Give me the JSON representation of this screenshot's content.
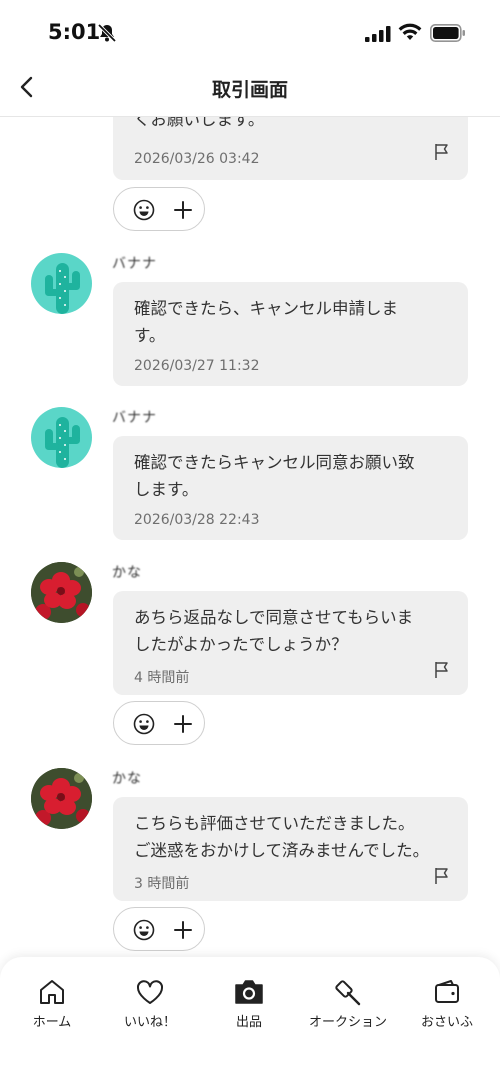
{
  "status_bar": {
    "time": "5:01",
    "icons": [
      "bell-muted-icon",
      "signal-icon",
      "wifi-icon",
      "battery-icon"
    ]
  },
  "header": {
    "title": "取引画面",
    "back_icon": "chevron-left-icon"
  },
  "messages": [
    {
      "sender": "",
      "text": "くお願いします。",
      "time": "2026/03/26 03:42",
      "avatar": "",
      "flag": true,
      "reactions": true
    },
    {
      "sender": "バナナ",
      "text": "確認できたら、キャンセル申請しま\nす。",
      "time": "2026/03/27 11:32",
      "avatar": "cactus-icon",
      "flag": false,
      "reactions": false
    },
    {
      "sender": "バナナ",
      "text": "確認できたらキャンセル同意お願い致\nします。",
      "time": "2026/03/28 22:43",
      "avatar": "cactus-icon",
      "flag": false,
      "reactions": false
    },
    {
      "sender": "かな",
      "text": "あちら返品なしで同意させてもらいま\nしたがよかったでしょうか？",
      "time": "4 時間前",
      "avatar": "flower-photo",
      "flag": true,
      "reactions": true
    },
    {
      "sender": "かな",
      "text": "こちらも評価させていただきました。\nご迷惑をおかけして済みませんでした。",
      "time": "3 時間前",
      "avatar": "flower-photo",
      "flag": true,
      "reactions": true
    }
  ],
  "bottom_nav": [
    {
      "label": "ホーム",
      "icon": "home-icon"
    },
    {
      "label": "いいね！",
      "icon": "heart-icon"
    },
    {
      "label": "出品",
      "icon": "camera-icon"
    },
    {
      "label": "オークション",
      "icon": "gavel-icon"
    },
    {
      "label": "おさいふ",
      "icon": "wallet-icon"
    }
  ],
  "colors": {
    "bubble": "#efefef",
    "cactus_avatar": "#5ad6c8",
    "text": "#333333",
    "meta_text": "#6f6f6f"
  }
}
